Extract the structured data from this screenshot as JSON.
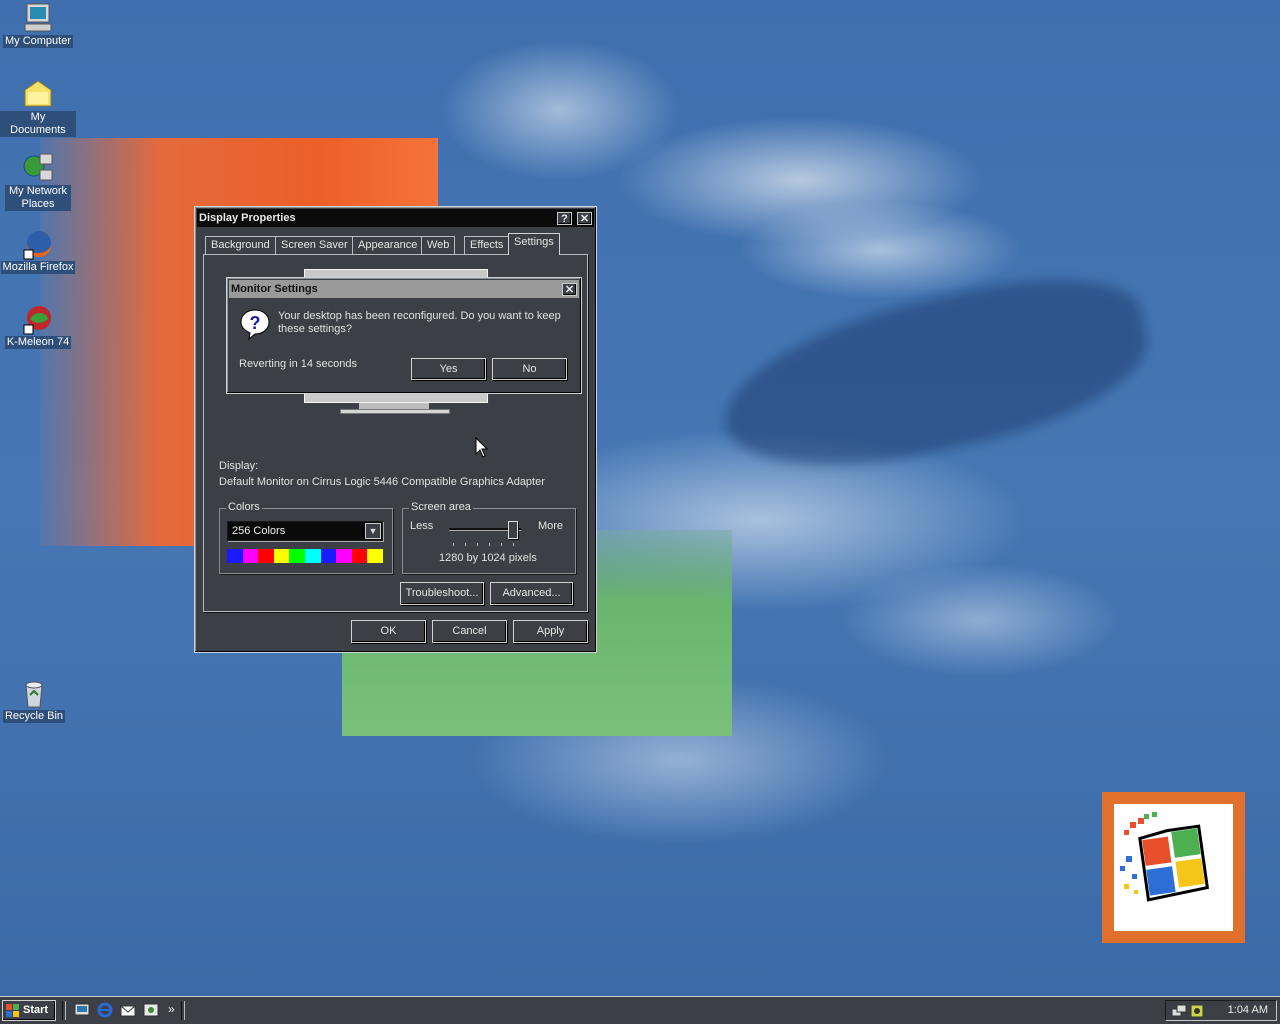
{
  "desktop": {
    "icons": [
      {
        "label": "My Computer"
      },
      {
        "label": "My Documents"
      },
      {
        "label": "My Network Places"
      },
      {
        "label": "Mozilla Firefox"
      },
      {
        "label": "K-Meleon 74"
      },
      {
        "label": "Recycle Bin"
      }
    ]
  },
  "display_properties": {
    "title": "Display Properties",
    "help_btn": "?",
    "close_btn": "✕",
    "tabs": [
      "Background",
      "Screen Saver",
      "Appearance",
      "Web",
      "Effects",
      "Settings"
    ],
    "active_tab": "Settings",
    "display_label": "Display:",
    "display_value": "Default Monitor on Cirrus Logic 5446 Compatible Graphics Adapter",
    "colors_legend": "Colors",
    "colors_selected": "256 Colors",
    "screen_area_legend": "Screen area",
    "slider_less": "Less",
    "slider_more": "More",
    "resolution": "1280 by 1024 pixels",
    "troubleshoot_btn": "Troubleshoot...",
    "advanced_btn": "Advanced...",
    "ok_btn": "OK",
    "cancel_btn": "Cancel",
    "apply_btn": "Apply"
  },
  "monitor_settings": {
    "title": "Monitor Settings",
    "close_btn": "✕",
    "message": "Your desktop has been reconfigured.  Do you want to keep these settings?",
    "countdown": "Reverting in 14 seconds",
    "yes_btn": "Yes",
    "no_btn": "No"
  },
  "taskbar": {
    "start_label": "Start",
    "chevron": "»",
    "clock": "1:04 AM"
  },
  "colors": {
    "window_bg": "#3c3f45",
    "titlebar": "#0b0b0b",
    "desktop": "#3f6fae"
  }
}
